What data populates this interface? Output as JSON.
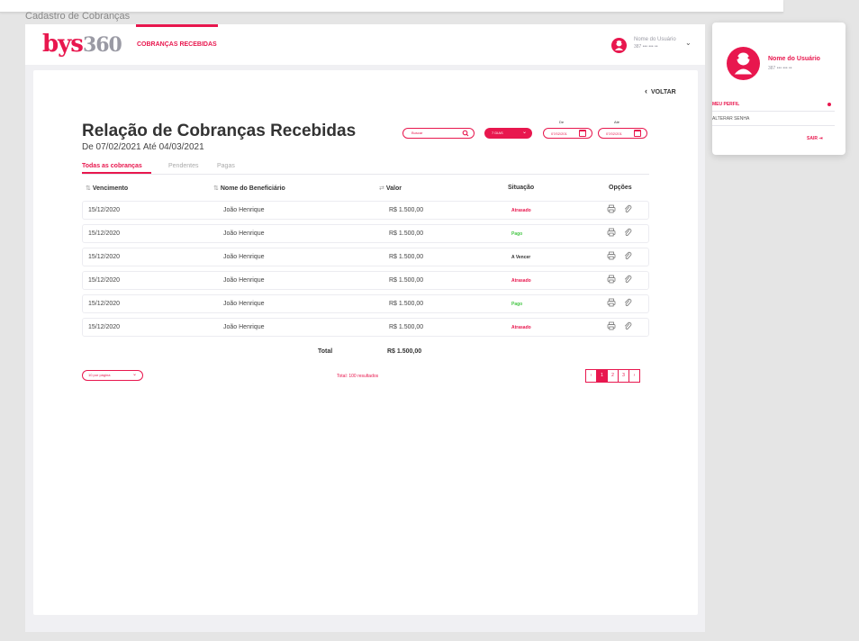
{
  "window": {
    "caption": "Cadastro de Cobranças"
  },
  "header": {
    "logo_bys": "bys",
    "logo_num": "360",
    "nav_active": "COBRANÇAS RECEBIDAS",
    "user_name": "Nome do Usuário",
    "user_id": "387 ••• ••• ••"
  },
  "page": {
    "back_label": "VOLTAR",
    "title": "Relação de Cobranças Recebidas",
    "subtitle": "De 07/02/2021 Até 04/03/2021"
  },
  "filters": {
    "search_placeholder": "Buscar",
    "period": "7 DIAS",
    "from_label": "De",
    "from_value": "07/02/201",
    "to_label": "Até",
    "to_value": "07/02/201"
  },
  "tabs": [
    "Todas as cobranças",
    "Pendentes",
    "Pagas"
  ],
  "table": {
    "columns": [
      "Vencimento",
      "Nome do Beneficiário",
      "Valor",
      "Situação",
      "Opções"
    ],
    "rows": [
      {
        "date": "15/12/2020",
        "name": "João Henrique",
        "value": "R$ 1.500,00",
        "status": "Atrasado"
      },
      {
        "date": "15/12/2020",
        "name": "João Henrique",
        "value": "R$ 1.500,00",
        "status": "Pago"
      },
      {
        "date": "15/12/2020",
        "name": "João Henrique",
        "value": "R$ 1.500,00",
        "status": "A Vencer"
      },
      {
        "date": "15/12/2020",
        "name": "João Henrique",
        "value": "R$ 1.500,00",
        "status": "Atrasado"
      },
      {
        "date": "15/12/2020",
        "name": "João Henrique",
        "value": "R$ 1.500,00",
        "status": "Pago"
      },
      {
        "date": "15/12/2020",
        "name": "João Henrique",
        "value": "R$ 1.500,00",
        "status": "Atrasado"
      }
    ],
    "total_label": "Total",
    "total_value": "R$ 1.500,00"
  },
  "footer": {
    "per_page": "10 por página",
    "results": "Total: 100 resultados",
    "pages": [
      "1",
      "2",
      "3"
    ],
    "current_page": "1"
  },
  "dropdown": {
    "name": "Nome do Usuário",
    "id": "387 ••• ••• ••",
    "profile": "MEU PERFIL",
    "change_password": "ALTERAR SENHA",
    "logout": "SAIR"
  },
  "colors": {
    "brand": "#e8174e",
    "late": "#e8174e",
    "paid": "#48c748",
    "due": "#333333"
  },
  "icons": [
    "search-icon",
    "chevron-down-icon",
    "calendar-icon",
    "sort-icon",
    "printer-icon",
    "paperclip-icon",
    "chevron-left-icon",
    "chevron-right-icon",
    "logout-icon",
    "user-avatar-icon"
  ]
}
